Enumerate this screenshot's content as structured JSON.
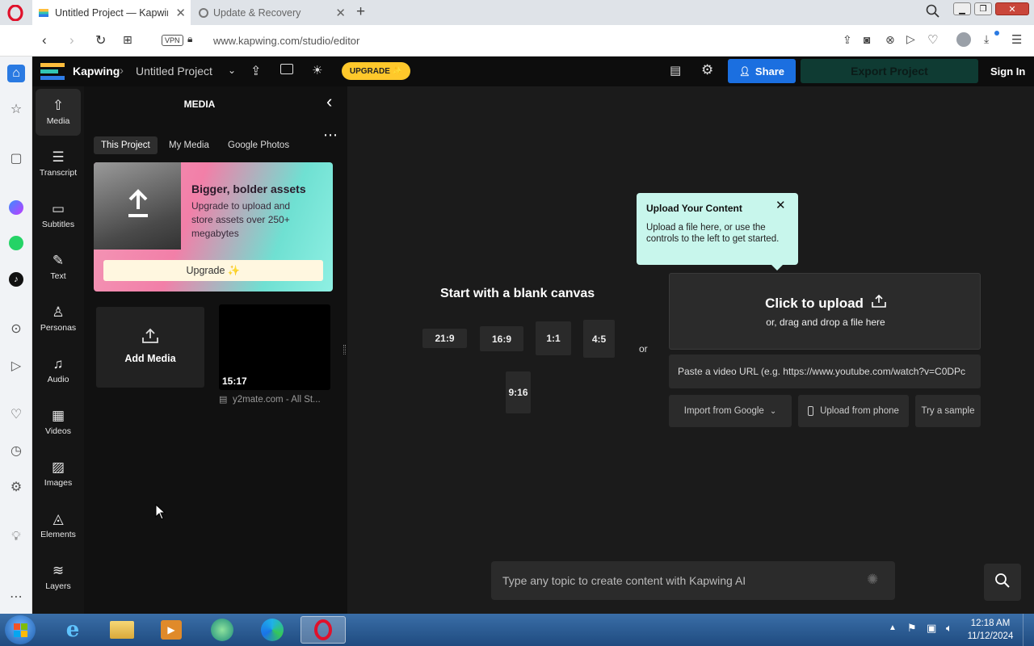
{
  "browser": {
    "tabs": [
      {
        "title": "Untitled Project — Kapwing",
        "active": true
      },
      {
        "title": "Update & Recovery",
        "active": false
      }
    ],
    "url": "www.kapwing.com/studio/editor",
    "vpn_label": "VPN"
  },
  "header": {
    "brand": "Kapwing",
    "project": "Untitled Project",
    "upgrade_label": "UPGRADE ✨",
    "share_label": "Share",
    "export_label": "Export Project",
    "signin_label": "Sign In"
  },
  "nav": {
    "items": [
      {
        "label": "Media",
        "icon": "upload-icon"
      },
      {
        "label": "Transcript",
        "icon": "transcript-icon"
      },
      {
        "label": "Subtitles",
        "icon": "subtitles-icon"
      },
      {
        "label": "Text",
        "icon": "text-icon"
      },
      {
        "label": "Personas",
        "icon": "person-icon"
      },
      {
        "label": "Audio",
        "icon": "music-icon"
      },
      {
        "label": "Videos",
        "icon": "film-icon"
      },
      {
        "label": "Images",
        "icon": "image-icon"
      },
      {
        "label": "Elements",
        "icon": "shapes-icon"
      },
      {
        "label": "Layers",
        "icon": "layers-icon"
      }
    ]
  },
  "media": {
    "title": "MEDIA",
    "tabs": [
      "This Project",
      "My Media",
      "Google Photos"
    ],
    "promo": {
      "heading": "Bigger, bolder assets",
      "body": "Upgrade to upload and store assets over 250+ megabytes",
      "button": "Upgrade ✨"
    },
    "add_media_label": "Add Media",
    "clip": {
      "duration": "15:17",
      "name": "y2mate.com - All St..."
    }
  },
  "canvas": {
    "blank_heading": "Start with a blank canvas",
    "ratios": [
      "21:9",
      "16:9",
      "1:1",
      "4:5",
      "9:16"
    ],
    "or_label": "or",
    "tooltip": {
      "title": "Upload Your Content",
      "body": "Upload a file here, or use the controls to the left to get started."
    },
    "upload": {
      "title": "Click to upload",
      "subtitle": "or, drag and drop a file here"
    },
    "url_placeholder": "Paste a video URL (e.g. https://www.youtube.com/watch?v=C0DPc",
    "import_google": "Import from Google",
    "upload_phone": "Upload from phone",
    "try_sample": "Try a sample",
    "ai_placeholder": "Type any topic to create content with Kapwing AI"
  },
  "taskbar": {
    "time": "12:18 AM",
    "date": "11/12/2024"
  }
}
